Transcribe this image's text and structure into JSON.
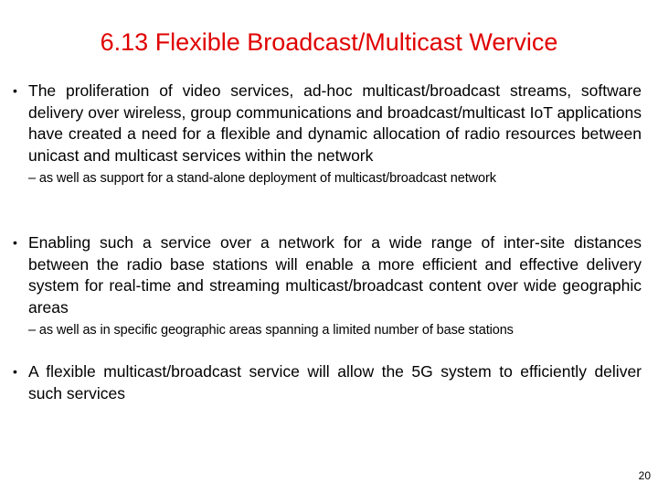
{
  "slide": {
    "title": "6.13 Flexible Broadcast/Multicast Wervice",
    "bullet_symbol": "•",
    "bullets": [
      {
        "text": "The proliferation of video services, ad-hoc multicast/broadcast streams, software delivery over wireless, group communications and broadcast/multicast IoT applications have created a need for a flexible and dynamic allocation of radio resources between unicast and multicast services within the network",
        "sub": "– as well as support for a stand-alone deployment of multicast/broadcast network"
      },
      {
        "text": "Enabling such a service over a network for a wide range of inter-site distances between the radio base stations will enable a more efficient and effective delivery system for real-time and streaming multicast/broadcast content over wide geographic areas",
        "sub": "– as well as in specific geographic areas spanning a limited number of base stations"
      },
      {
        "text": "A flexible multicast/broadcast service will allow the 5G system to efficiently deliver such services"
      }
    ],
    "page_number": "20"
  }
}
